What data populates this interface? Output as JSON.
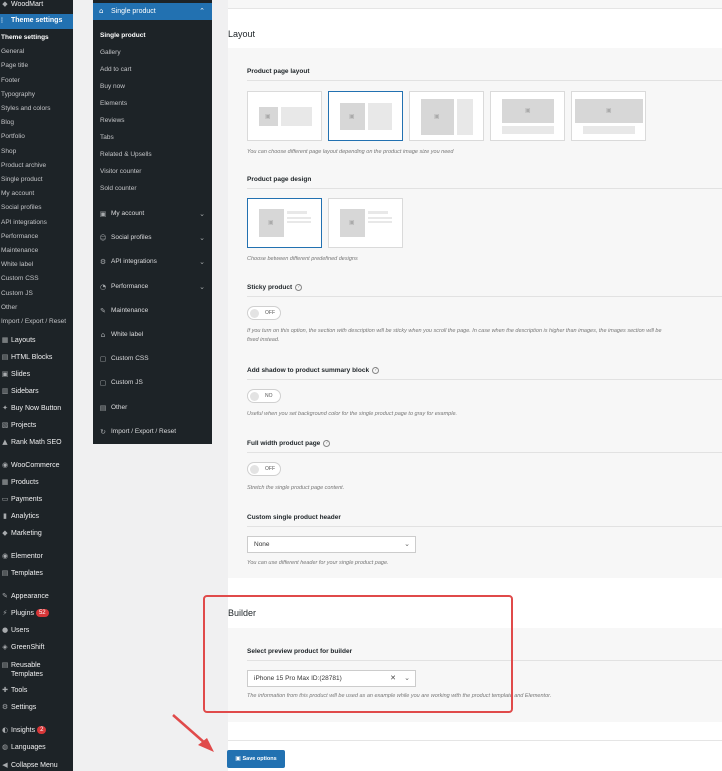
{
  "wp_menu": {
    "brand": "WoodMart",
    "theme_settings": "Theme settings",
    "submenu": [
      "Theme settings",
      "General",
      "Page title",
      "Footer",
      "Typography",
      "Styles and colors",
      "Blog",
      "Portfolio",
      "Shop",
      "Product archive",
      "Single product",
      "My account",
      "Social profiles",
      "API integrations",
      "Performance",
      "Maintenance",
      "White label",
      "Custom CSS",
      "Custom JS",
      "Other",
      "Import / Export / Reset"
    ],
    "items": [
      {
        "label": "Layouts",
        "icon": "layouts-icon",
        "glyph": "▦"
      },
      {
        "label": "HTML Blocks",
        "icon": "html-blocks-icon",
        "glyph": "▤"
      },
      {
        "label": "Slides",
        "icon": "slides-icon",
        "glyph": "▣"
      },
      {
        "label": "Sidebars",
        "icon": "sidebars-icon",
        "glyph": "▥"
      },
      {
        "label": "Buy Now Button",
        "icon": "buy-now-icon",
        "glyph": "✦"
      },
      {
        "label": "Projects",
        "icon": "projects-icon",
        "glyph": "▧"
      },
      {
        "label": "Rank Math SEO",
        "icon": "rank-math-icon",
        "glyph": "▲"
      },
      {
        "label": "WooCommerce",
        "icon": "woocommerce-icon",
        "glyph": "◉"
      },
      {
        "label": "Products",
        "icon": "products-icon",
        "glyph": "▦"
      },
      {
        "label": "Payments",
        "icon": "payments-icon",
        "glyph": "▭"
      },
      {
        "label": "Analytics",
        "icon": "analytics-icon",
        "glyph": "▮"
      },
      {
        "label": "Marketing",
        "icon": "marketing-icon",
        "glyph": "◆"
      },
      {
        "label": "Elementor",
        "icon": "elementor-icon",
        "glyph": "◉"
      },
      {
        "label": "Templates",
        "icon": "templates-icon",
        "glyph": "▤"
      },
      {
        "label": "Appearance",
        "icon": "appearance-icon",
        "glyph": "✎"
      },
      {
        "label": "Plugins",
        "icon": "plugins-icon",
        "glyph": "⚡",
        "badge": "52"
      },
      {
        "label": "Users",
        "icon": "users-icon",
        "glyph": "●"
      },
      {
        "label": "GreenShift",
        "icon": "greenshift-icon",
        "glyph": "◈"
      },
      {
        "label": "Reusable Templates",
        "icon": "reusable-templates-icon",
        "glyph": "▤"
      },
      {
        "label": "Tools",
        "icon": "tools-icon",
        "glyph": "✚"
      },
      {
        "label": "Settings",
        "icon": "settings-icon",
        "glyph": "⚙"
      },
      {
        "label": "Insights",
        "icon": "insights-icon",
        "glyph": "◐",
        "badge": "2"
      },
      {
        "label": "Languages",
        "icon": "languages-icon",
        "glyph": "◍"
      },
      {
        "label": "Collapse Menu",
        "icon": "collapse-icon",
        "glyph": "◀"
      }
    ]
  },
  "panel": {
    "section": "Single product",
    "subitems": [
      "Single product",
      "Gallery",
      "Add to cart",
      "Buy now",
      "Elements",
      "Reviews",
      "Tabs",
      "Related & Upsells",
      "Visitor counter",
      "Sold counter"
    ],
    "items": [
      {
        "label": "My account",
        "icon": "account-icon",
        "glyph": "▣",
        "chevron": "⌄"
      },
      {
        "label": "Social profiles",
        "icon": "social-icon",
        "glyph": "☺",
        "chevron": "⌄"
      },
      {
        "label": "API integrations",
        "icon": "api-icon",
        "glyph": "⚙",
        "chevron": "⌄"
      },
      {
        "label": "Performance",
        "icon": "performance-icon",
        "glyph": "◔",
        "chevron": "⌄"
      },
      {
        "label": "Maintenance",
        "icon": "maintenance-icon",
        "glyph": "✎"
      },
      {
        "label": "White label",
        "icon": "white-label-icon",
        "glyph": "⌂"
      },
      {
        "label": "Custom CSS",
        "icon": "css-icon",
        "glyph": "▢"
      },
      {
        "label": "Custom JS",
        "icon": "js-icon",
        "glyph": "▢"
      },
      {
        "label": "Other",
        "icon": "other-icon",
        "glyph": "▤"
      },
      {
        "label": "Import / Export / Reset",
        "icon": "import-export-icon",
        "glyph": "↻"
      }
    ]
  },
  "layout": {
    "title": "Layout",
    "page_layout_label": "Product page layout",
    "page_layout_hint": "You can choose different page layout depending on the product image size you need",
    "page_design_label": "Product page design",
    "page_design_hint": "Choose between different predefined designs",
    "sticky_label": "Sticky product",
    "sticky_value": "OFF",
    "sticky_hint_1": "If you turn on this option, the section with description will be sticky when you scroll the page. In case when the description is higher than images, the images section will be",
    "sticky_hint_2": "fixed instead.",
    "shadow_label": "Add shadow to product summary block",
    "shadow_value": "NO",
    "shadow_hint": "Useful when you set background color for the single product page to gray for example.",
    "fullwidth_label": "Full width product page",
    "fullwidth_value": "OFF",
    "fullwidth_hint": "Stretch the single product page content.",
    "header_label": "Custom single product header",
    "header_value": "None",
    "header_hint": "You can use different header for your single product page."
  },
  "builder": {
    "title": "Builder",
    "preview_label": "Select preview product for builder",
    "preview_value": "iPhone 15 Pro Max ID:(28781)",
    "preview_hint": "The information from this product will be used as an example while you are working with the product template and Elementor."
  },
  "save_label": "Save options",
  "highlight_color": "#e04a4a",
  "accent_color": "#2271b1"
}
